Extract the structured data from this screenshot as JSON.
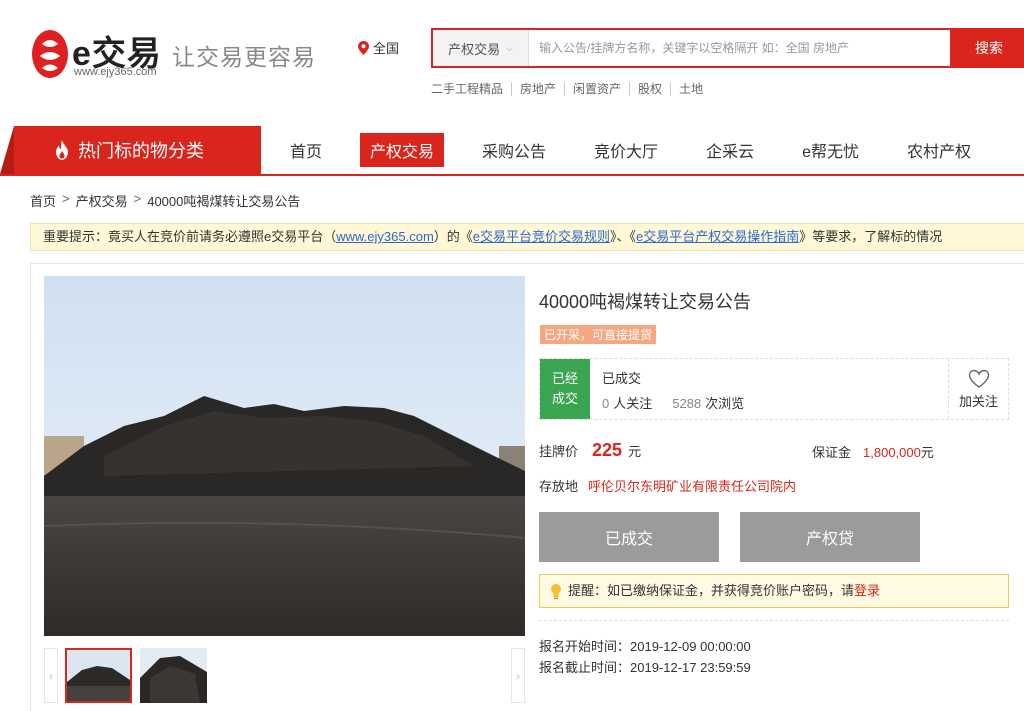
{
  "header": {
    "logo_text": "e交易",
    "logo_url": "www.ejy365.com",
    "slogan": "让交易更容易",
    "region": "全国",
    "search_category": "产权交易",
    "search_placeholder": "输入公告/挂牌方名称，关键字以空格隔开 如：全国 房地产",
    "search_button": "搜索",
    "hot_links": [
      "二手工程精品",
      "房地产",
      "闲置资产",
      "股权",
      "土地"
    ]
  },
  "nav": {
    "category_button": "热门标的物分类",
    "items": [
      "首页",
      "产权交易",
      "采购公告",
      "竞价大厅",
      "企采云",
      "e帮无忧",
      "农村产权"
    ],
    "active_index": 1
  },
  "breadcrumb": [
    "首页",
    "产权交易",
    "40000吨褐煤转让交易公告"
  ],
  "notice": {
    "prefix": "重要提示：竟买人在竞价前请务必遵照e交易平台（",
    "link1": "www.ejy365.com",
    "mid1": "）的《",
    "link2": "e交易平台竞价交易规则",
    "mid2": "》、《",
    "link3": "e交易平台产权交易操作指南",
    "suffix": "》等要求，了解标的情况"
  },
  "listing": {
    "title": "40000吨褐煤转让交易公告",
    "tag": "已开采，可直接提货",
    "status_badge_line1": "已经",
    "status_badge_line2": "成交",
    "status_text": "已成交",
    "followers": "0",
    "followers_label": "人关注",
    "views": "5288",
    "views_label": "次浏览",
    "follow_label": "加关注",
    "price_label": "挂牌价",
    "price": "225",
    "price_unit": "元",
    "deposit_label": "保证金",
    "deposit": "1,800,000",
    "deposit_unit": "元",
    "storage_label": "存放地",
    "storage": "呼伦贝尔东明矿业有限责任公司院内",
    "button_done": "已成交",
    "button_loan": "产权贷",
    "remind_text": "提醒：如已缴纳保证金，并获得竞价账户密码，请",
    "remind_login": "登录",
    "start_label": "报名开始时间：",
    "start_time": "2019-12-09 00:00:00",
    "end_label": "报名截止时间：",
    "end_time": "2019-12-17 23:59:59"
  },
  "colors": {
    "brand_red": "#d9251c",
    "status_green": "#3aa651",
    "tag_orange": "#f6a680"
  }
}
